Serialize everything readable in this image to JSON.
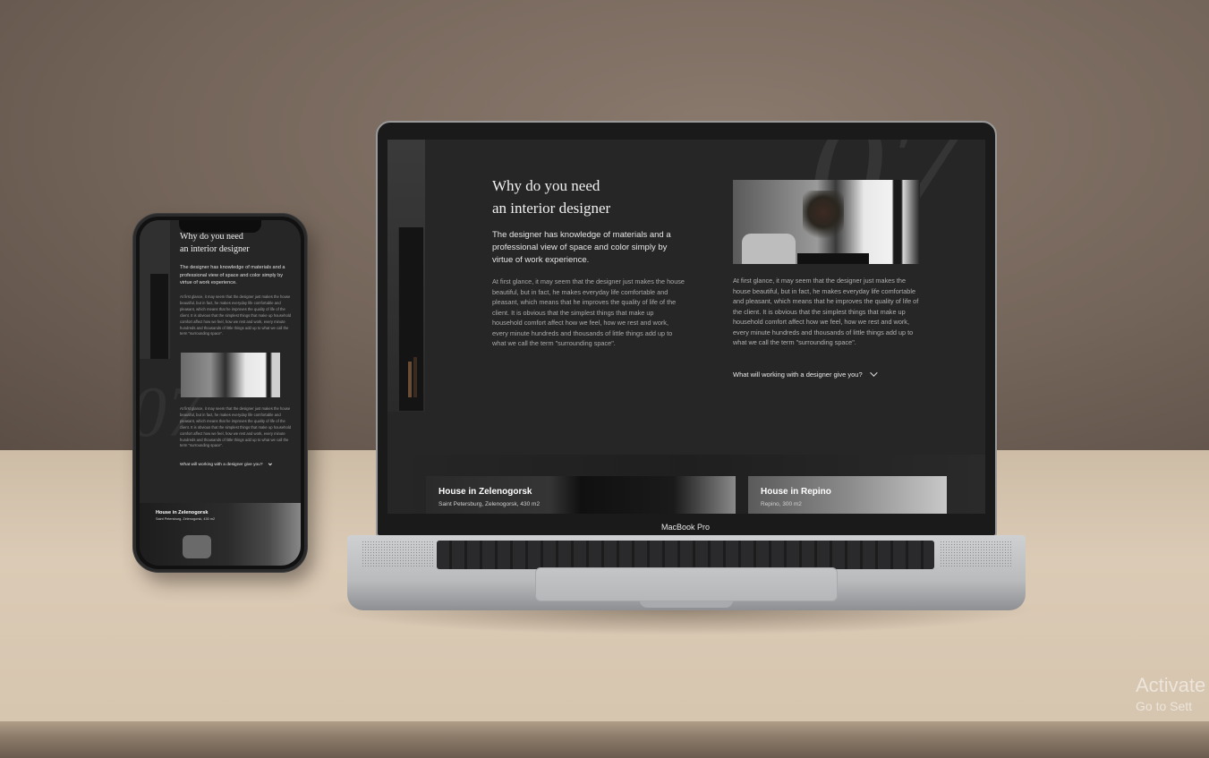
{
  "laptop": {
    "brand": "MacBook Pro",
    "section_number": "07",
    "title_line1": "Why do you need",
    "title_line2": "an interior designer",
    "lead": "The designer has knowledge of materials and a professional view of space and color simply by virtue of work experience.",
    "body_left": "At first glance, it may seem that the designer just makes the house beautiful, but in fact, he makes everyday life comfortable and pleasant, which means that he improves the quality of life of the client. It is obvious that the simplest things that make up household comfort affect how we feel, how we rest and work, every minute hundreds and thousands of little things add up to what we call the term \"surrounding space\".",
    "body_right": "At first glance, it may seem that the designer just makes the house beautiful, but in fact, he makes everyday life comfortable and pleasant, which means that he improves the quality of life of the client. It is obvious that the simplest things that make up household comfort affect how we feel, how we rest and work, every minute hundreds and thousands of little things add up to what we call the term \"surrounding space\".",
    "accordion_label": "What will working with a designer give you?",
    "cards": [
      {
        "title": "House in Zelenogorsk",
        "subtitle": "Saint Petersburg, Zelenogorsk, 430 m2"
      },
      {
        "title": "House in Repino",
        "subtitle": "Repino, 300 m2"
      }
    ]
  },
  "phone": {
    "title_line1": "Why do you need",
    "title_line2": "an interior designer",
    "lead": "The designer has knowledge of materials and a professional view of space and color simply by virtue of work experience.",
    "body_top": "At first glance, it may seem that the designer just makes the house beautiful, but in fact, he makes everyday life comfortable and pleasant, which means that he improves the quality of life of the client. It is obvious that the simplest things that make up household comfort affect how we feel, how we rest and work, every minute hundreds and thousands of little things add up to what we call the term \"surrounding space\".",
    "body_bottom": "At first glance, it may seem that the designer just makes the house beautiful, but in fact, he makes everyday life comfortable and pleasant, which means that he improves the quality of life of the client. It is obvious that the simplest things that make up household comfort affect how we feel, how we rest and work, every minute hundreds and thousands of little things add up to what we call the term \"surrounding space\".",
    "accordion_label": "What will working with a designer give you?",
    "card_title": "House in Zelenogorsk",
    "card_subtitle": "Saint Petersburg, Zelenogorsk, 430 m2"
  },
  "watermark": {
    "line1": "Activate",
    "line2": "Go to Sett"
  },
  "colors": {
    "screen_bg": "#262626",
    "wall": "#7a6a5f",
    "desk": "#d6c5af"
  },
  "icons": [
    "chevron-down-icon"
  ]
}
